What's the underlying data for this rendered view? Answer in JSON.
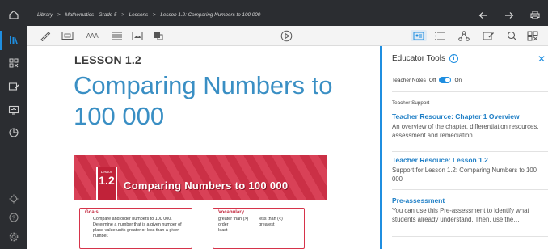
{
  "breadcrumb": {
    "parts": [
      "Library",
      ">",
      "Mathematics - Grade 5",
      ">",
      "Lessons",
      ">",
      "Lesson 1.2: Comparing Numbers to 100 000"
    ]
  },
  "toolbar": {
    "font_size_label": "AAA"
  },
  "lesson": {
    "label": "LESSON 1.2",
    "title": "Comparing Numbers to 100 000"
  },
  "banner": {
    "badge_small": "Lesson",
    "badge_number": "1.2",
    "title": "Comparing Numbers to 100 000",
    "goals_title": "Goals",
    "goals": [
      "Compare and order numbers to 100 000.",
      "Determine a number that is a given number of place-value units greater or less than a given number."
    ],
    "vocab_title": "Vocabulary",
    "vocab": [
      "greater than (>)",
      "less than (<)",
      "order",
      "greatest",
      "least",
      ""
    ]
  },
  "panel": {
    "title": "Educator Tools",
    "close_glyph": "✕",
    "notes_label": "Teacher Notes",
    "notes_off": "Off",
    "notes_on": "On",
    "support_label": "Teacher Support",
    "resources": [
      {
        "title": "Teacher Resource: Chapter 1 Overview",
        "desc": "An overview of the chapter, differentiation resources, assessment and remediation…"
      },
      {
        "title": "Teacher Resouce: Lesson 1.2",
        "desc": "Support for Lesson 1.2: Comparing Numbers to 100 000"
      },
      {
        "title": "Pre-assessment",
        "desc": "You can use this Pre-assessment to identify what students already understand. Then, use the…"
      }
    ]
  },
  "colors": {
    "accent": "#1f8ee0",
    "title_blue": "#3a8fc4",
    "banner_red": "#d6334a",
    "chrome": "#2b2d31"
  },
  "icons": [
    "home-icon",
    "library-icon",
    "apps-icon",
    "assignments-icon",
    "present-icon",
    "reports-icon",
    "settings-dial-icon",
    "help-icon",
    "gear-icon",
    "back-arrow-icon",
    "forward-arrow-icon",
    "print-icon",
    "pen-icon",
    "screen-icon",
    "font-size-icon",
    "line-spacing-icon",
    "image-icon",
    "translate-icon",
    "play-icon",
    "educator-tools-icon",
    "toc-icon",
    "network-icon",
    "notes-edit-icon",
    "search-icon",
    "grid-icon",
    "info-icon",
    "close-icon"
  ]
}
